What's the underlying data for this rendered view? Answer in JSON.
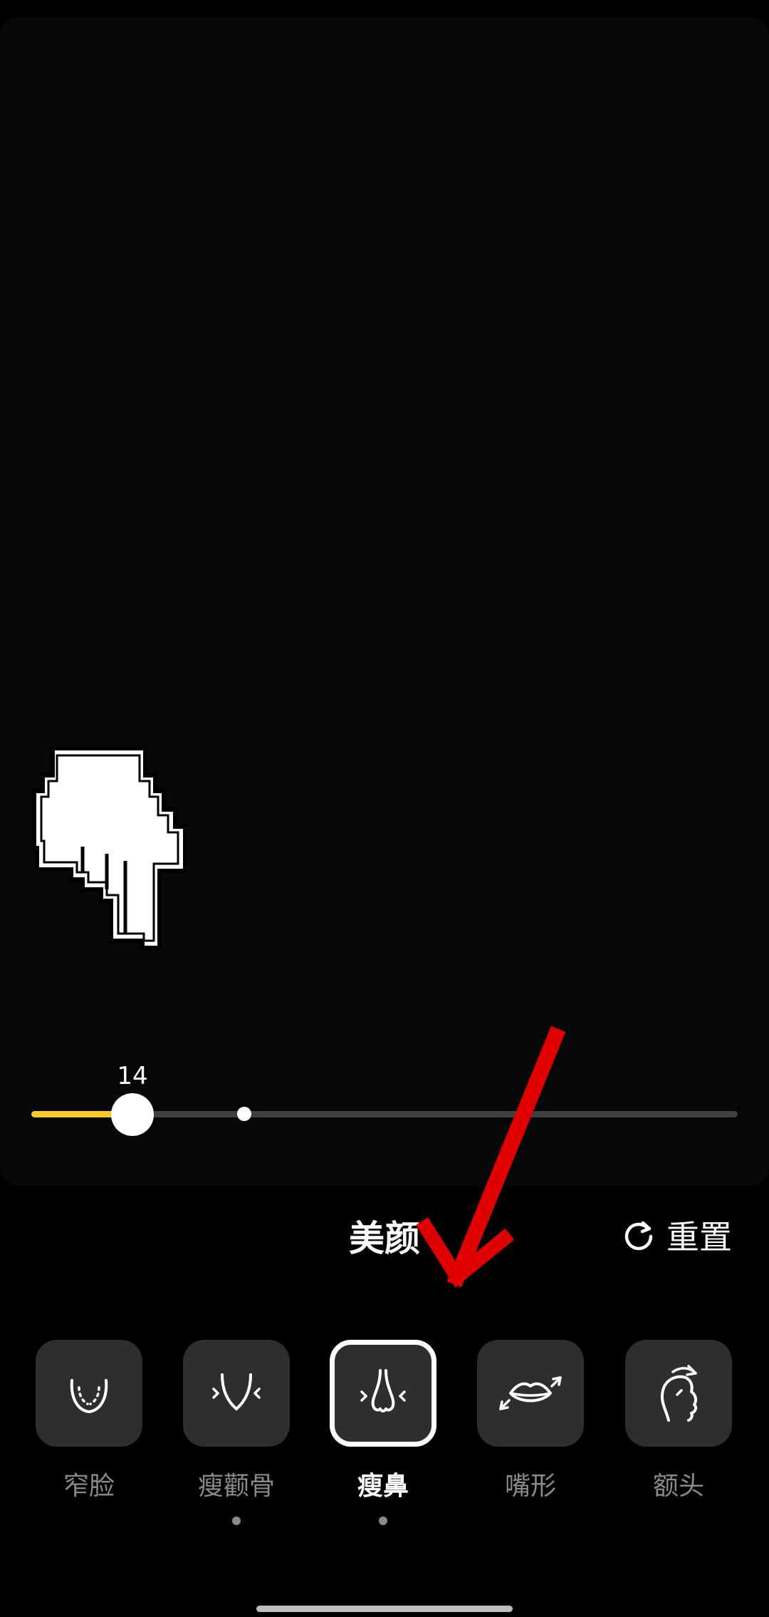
{
  "slider": {
    "value_label": "14",
    "value": 14,
    "min": 0,
    "max": 100,
    "default_marker": 30,
    "fill_color": "#f6c928",
    "track_color": "#3f3f3f"
  },
  "panel": {
    "title": "美颜",
    "reset_label": "重置",
    "reset_icon": "refresh-icon"
  },
  "tools": [
    {
      "label": "窄脸",
      "icon": "narrow-face-icon",
      "selected": false,
      "has_dot": false
    },
    {
      "label": "瘦颧骨",
      "icon": "cheekbone-icon",
      "selected": false,
      "has_dot": true
    },
    {
      "label": "瘦鼻",
      "icon": "nose-icon",
      "selected": true,
      "has_dot": true
    },
    {
      "label": "嘴形",
      "icon": "lips-icon",
      "selected": false,
      "has_dot": false
    },
    {
      "label": "额头",
      "icon": "forehead-icon",
      "selected": false,
      "has_dot": false
    }
  ],
  "overlays": {
    "pointer_icon": "pixel-hand-pointer-icon",
    "arrow_icon": "red-arrow-annotation-icon",
    "arrow_color": "#e00000"
  }
}
